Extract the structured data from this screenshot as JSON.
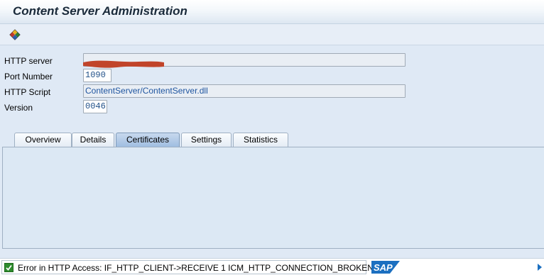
{
  "window": {
    "title": "Content Server Administration"
  },
  "toolbar": {
    "items": [
      {
        "icon": "execute-diamond-icon"
      }
    ]
  },
  "form": {
    "http_server": {
      "label": "HTTP server",
      "value": ""
    },
    "port_number": {
      "label": "Port Number",
      "value": "1090"
    },
    "http_script": {
      "label": "HTTP Script",
      "value": "ContentServer/ContentServer.dll"
    },
    "version": {
      "label": "Version",
      "value": "0046"
    }
  },
  "tabs": [
    {
      "label": "Overview",
      "active": false
    },
    {
      "label": "Details",
      "active": false
    },
    {
      "label": "Certificates",
      "active": true
    },
    {
      "label": "Settings",
      "active": false
    },
    {
      "label": "Statistics",
      "active": false
    }
  ],
  "status_bar": {
    "message": "Error in HTTP Access: IF_HTTP_CLIENT->RECEIVE 1 ICM_HTTP_CONNECTION_BROKEN",
    "logo": "SAP"
  },
  "colors": {
    "active_tab": "#9ebce0",
    "status_check": "#2e8b2e",
    "sap_logo": "#1b6fc0",
    "redaction": "#c1442a"
  }
}
